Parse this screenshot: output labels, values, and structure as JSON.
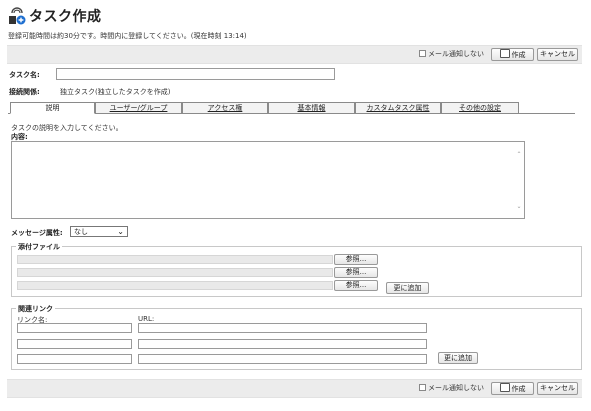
{
  "header": {
    "title": "タスク作成",
    "icon": "task-create-icon",
    "notice": "登録可能時間は約30分です。時間内に登録してください。(現在時刻  13:14)"
  },
  "toolbar": {
    "mail_no_notify": "メール通知しない",
    "create_label": "作成",
    "cancel_label": "キャンセル"
  },
  "form": {
    "task_name_label": "タスク名:",
    "task_name_value": "",
    "relation_label": "接続関係:",
    "relation_value": "独立タスク(独立したタスクを作成)"
  },
  "tabs": [
    {
      "label": "説明",
      "active": true
    },
    {
      "label": "ユーザー/グループ",
      "active": false
    },
    {
      "label": "アクセス権",
      "active": false
    },
    {
      "label": "基本情報",
      "active": false
    },
    {
      "label": "カスタムタスク属性",
      "active": false
    },
    {
      "label": "その他の設定",
      "active": false
    }
  ],
  "description": {
    "hint": "タスクの説明を入力してください。",
    "content_label": "内容:",
    "content_value": ""
  },
  "message_attr": {
    "label": "メッセージ属性:",
    "selected": "なし"
  },
  "attachments": {
    "legend": "添付ファイル",
    "browse_label": "参照...",
    "add_more_label": "更に追加"
  },
  "links": {
    "legend": "関連リンク",
    "name_header": "リンク名:",
    "url_header": "URL:",
    "add_more_label": "更に追加"
  },
  "colors": {
    "toolbar_bg": "#ececec",
    "icon_blue": "#1e6fd0"
  }
}
